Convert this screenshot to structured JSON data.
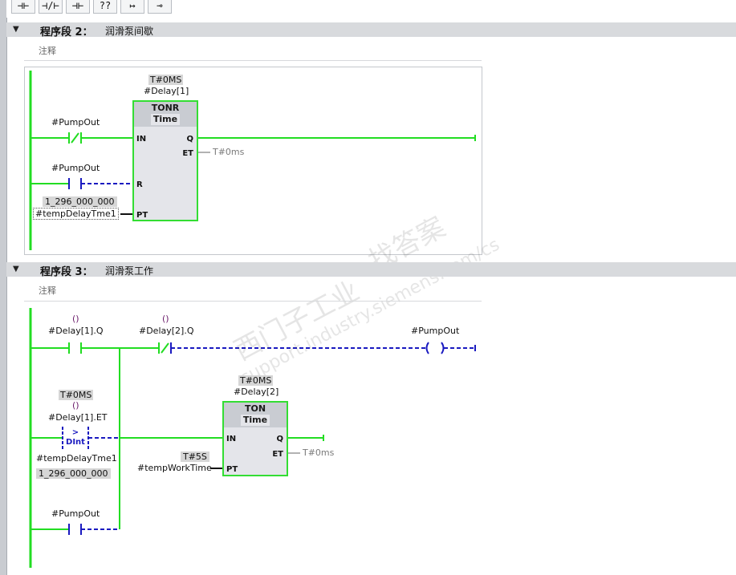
{
  "toolbar": {
    "buttons": [
      {
        "name": "insert-nc-contact-button",
        "glyph": "⊣⊢"
      },
      {
        "name": "insert-no-contact-button",
        "glyph": "⊣/⊢"
      },
      {
        "name": "insert-coil-button",
        "glyph": "⊣⊢"
      },
      {
        "name": "empty-box-button",
        "glyph": "??"
      },
      {
        "name": "open-branch-button",
        "glyph": "↦"
      },
      {
        "name": "close-branch-button",
        "glyph": "⊸"
      }
    ]
  },
  "network2": {
    "label": "程序段 2：",
    "description": "润滑泵间歇",
    "comment": "注释",
    "timer_preset_top": "T#0MS",
    "instance": "#Delay[1]",
    "block_type": "TONR",
    "block_subtype": "Time",
    "pin_in": "IN",
    "pin_r": "R",
    "pin_pt": "PT",
    "pin_q": "Q",
    "pin_et": "ET",
    "contact1_tag": "#PumpOut",
    "contact2_tag": "#PumpOut",
    "pt_value": "1_296_000_000",
    "pt_tag": "#tempDelayTme1",
    "et_value": "T#0ms"
  },
  "network3": {
    "label": "程序段 3：",
    "description": "润滑泵工作",
    "comment": "注释",
    "paren": "()",
    "contact1_tag": "#Delay[1].Q",
    "contact2_tag": "#Delay[2].Q",
    "coil_tag": "#PumpOut",
    "cmp_preset": "T#0MS",
    "cmp_tag": "#Delay[1].ET",
    "cmp_op": ">",
    "cmp_type": "DInt",
    "cmp_operand2_tag": "#tempDelayTme1",
    "cmp_operand2_value": "1_296_000_000",
    "contact3_tag": "#PumpOut",
    "timer_preset_top": "T#0MS",
    "instance": "#Delay[2]",
    "block_type": "TON",
    "block_subtype": "Time",
    "pin_in": "IN",
    "pin_pt": "PT",
    "pin_q": "Q",
    "pin_et": "ET",
    "pt_value": "T#5S",
    "pt_tag": "#tempWorkTime",
    "et_value": "T#0ms"
  },
  "watermark": {
    "line1": "西门子工业",
    "line2": "找答案",
    "line3": "support.industry.siemens.com/cs"
  },
  "colors": {
    "power_flow": "#22dd22",
    "no_flow": "#1a1ac0",
    "header_bg": "#d8dadd"
  }
}
